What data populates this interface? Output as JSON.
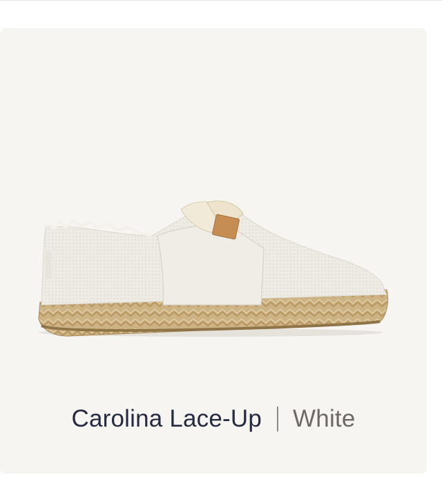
{
  "product": {
    "name": "Carolina Lace-Up",
    "color": "White",
    "image_icon": "espadrille-shoe-image"
  },
  "colors": {
    "card_bg": "#f7f5f2",
    "name_text": "#262a3f",
    "color_text": "#6d6a66",
    "canvas": "#efe9df",
    "jute": "#c9ad7d",
    "tag": "#c38b50"
  }
}
